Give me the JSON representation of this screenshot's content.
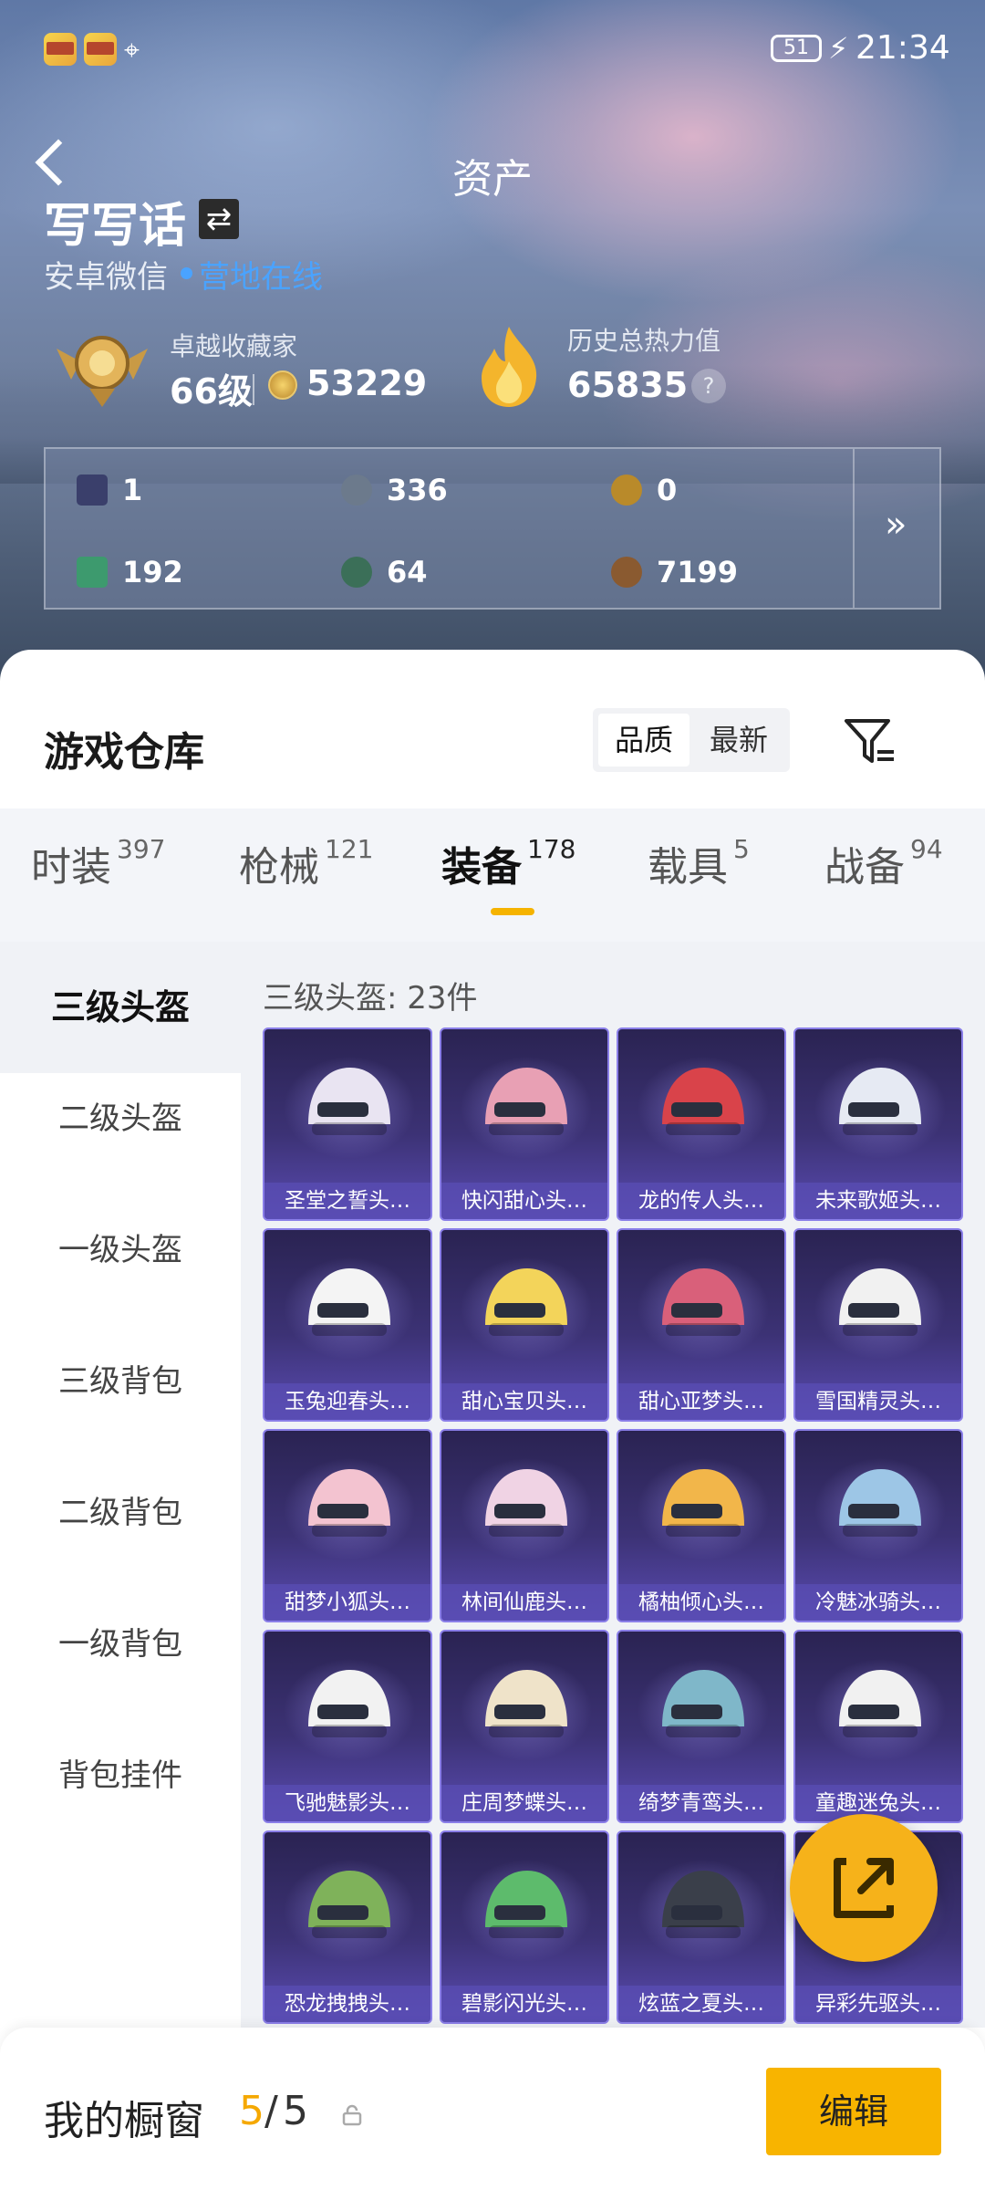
{
  "status_bar": {
    "battery": "51",
    "time": "21:34"
  },
  "header": {
    "title": "资产"
  },
  "profile": {
    "name": "写写话",
    "platform": "安卓微信",
    "online_status": "营地在线",
    "collector": {
      "label": "卓越收藏家",
      "level": "66级",
      "points": "53229"
    },
    "heat": {
      "label": "历史总热力值",
      "value": "65835",
      "help": "?"
    }
  },
  "currencies": [
    {
      "icon": "card-icon",
      "value": "1",
      "color": "#3a3f6b"
    },
    {
      "icon": "silver-coin-icon",
      "value": "336",
      "color": "#6c7a8c"
    },
    {
      "icon": "gold-coin-icon",
      "value": "0",
      "color": "#b98a2a"
    },
    {
      "icon": "green-card-icon",
      "value": "192",
      "color": "#3d9a6e"
    },
    {
      "icon": "green-orb-icon",
      "value": "64",
      "color": "#3b6f58"
    },
    {
      "icon": "bronze-coin-icon",
      "value": "7199",
      "color": "#8a5a30"
    }
  ],
  "warehouse": {
    "title": "游戏仓库",
    "sort": {
      "options": [
        "品质",
        "最新"
      ],
      "selected": "品质"
    },
    "tabs": [
      {
        "label": "时装",
        "count": "397"
      },
      {
        "label": "枪械",
        "count": "121"
      },
      {
        "label": "装备",
        "count": "178"
      },
      {
        "label": "载具",
        "count": "5"
      },
      {
        "label": "战备",
        "count": "94"
      }
    ],
    "active_tab": "装备",
    "categories": [
      "三级头盔",
      "二级头盔",
      "一级头盔",
      "三级背包",
      "二级背包",
      "一级背包",
      "背包挂件"
    ],
    "active_category": "三级头盔",
    "grid_header": "三级头盔: 23件",
    "items": [
      {
        "name": "圣堂之誓头…",
        "color": "#e9e4f2"
      },
      {
        "name": "快闪甜心头…",
        "color": "#e8a0b4"
      },
      {
        "name": "龙的传人头…",
        "color": "#d9434a"
      },
      {
        "name": "未来歌姬头…",
        "color": "#e6eaf3"
      },
      {
        "name": "玉兔迎春头…",
        "color": "#f4f4f4"
      },
      {
        "name": "甜心宝贝头…",
        "color": "#f3d45a"
      },
      {
        "name": "甜心亚梦头…",
        "color": "#d9607a"
      },
      {
        "name": "雪国精灵头…",
        "color": "#f1f1f1"
      },
      {
        "name": "甜梦小狐头…",
        "color": "#f3c3d0"
      },
      {
        "name": "林间仙鹿头…",
        "color": "#f0d3e4"
      },
      {
        "name": "橘柚倾心头…",
        "color": "#f2b64a"
      },
      {
        "name": "冷魅冰骑头…",
        "color": "#9dc6e6"
      },
      {
        "name": "飞驰魅影头…",
        "color": "#f2f2f2"
      },
      {
        "name": "庄周梦蝶头…",
        "color": "#efe3c9"
      },
      {
        "name": "绮梦青鸾头…",
        "color": "#7fb7c9"
      },
      {
        "name": "童趣迷兔头…",
        "color": "#f1f1f1"
      },
      {
        "name": "恐龙拽拽头…",
        "color": "#7fb25a"
      },
      {
        "name": "碧影闪光头…",
        "color": "#5dbb6c"
      },
      {
        "name": "炫蓝之夏头…",
        "color": "#3a3f4a"
      },
      {
        "name": "异彩先驱头…",
        "color": "#c8b6e6"
      }
    ]
  },
  "showcase": {
    "label": "我的橱窗",
    "count": "5",
    "total": "5",
    "edit_label": "编辑"
  }
}
